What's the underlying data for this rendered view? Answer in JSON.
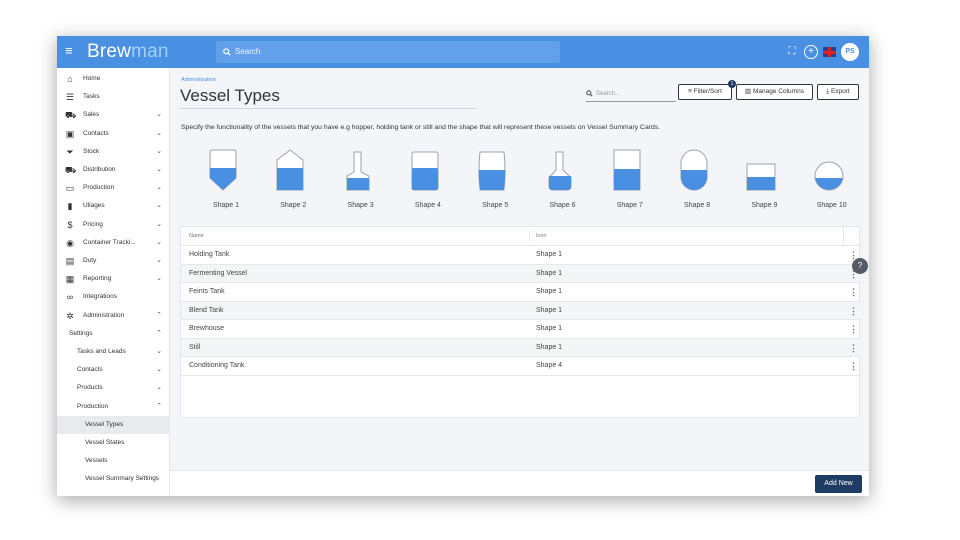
{
  "app": {
    "logo_a": "Brew",
    "logo_b": "man",
    "search_placeholder": "Search",
    "avatar": "PS"
  },
  "sidebar": {
    "items": [
      {
        "label": "Home",
        "icon": "home-icon",
        "chevron": ""
      },
      {
        "label": "Tasks",
        "icon": "list-icon",
        "chevron": ""
      },
      {
        "label": "Sales",
        "icon": "cart-icon",
        "chevron": "⌄"
      },
      {
        "label": "Contacts",
        "icon": "contact-card-icon",
        "chevron": "⌄"
      },
      {
        "label": "Stock",
        "icon": "filter-icon",
        "chevron": "⌄"
      },
      {
        "label": "Distribution",
        "icon": "truck-icon",
        "chevron": "⌄"
      },
      {
        "label": "Production",
        "icon": "tank-icon",
        "chevron": "⌄"
      },
      {
        "label": "Ullages",
        "icon": "bin-icon",
        "chevron": "⌄"
      },
      {
        "label": "Pricing",
        "icon": "dollar-icon",
        "chevron": "⌄"
      },
      {
        "label": "Container Tracki...",
        "icon": "target-icon",
        "chevron": "⌄"
      },
      {
        "label": "Duty",
        "icon": "duty-icon",
        "chevron": "⌄"
      },
      {
        "label": "Reporting",
        "icon": "report-icon",
        "chevron": "⌄"
      },
      {
        "label": "Integrations",
        "icon": "link-icon",
        "chevron": ""
      },
      {
        "label": "Administration",
        "icon": "gear-icon",
        "chevron": "⌃"
      }
    ],
    "settings": {
      "label": "Settings",
      "chevron": "⌃"
    },
    "settings_items": [
      {
        "label": "Tasks and Leads",
        "chevron": "⌄"
      },
      {
        "label": "Contacts",
        "chevron": "⌄"
      },
      {
        "label": "Products",
        "chevron": "⌄"
      },
      {
        "label": "Production",
        "chevron": "⌃"
      }
    ],
    "production_items": [
      {
        "label": "Vessel Types",
        "active": true
      },
      {
        "label": "Vessel States",
        "active": false
      },
      {
        "label": "Vessels",
        "active": false
      },
      {
        "label": "Vessel Summary Settings",
        "active": false
      }
    ]
  },
  "main": {
    "breadcrumb": "Administration",
    "title": "Vessel Types",
    "search_placeholder": "Search...",
    "filter_label": "Filter/Sort",
    "filter_badge": "1",
    "manage_columns_label": "Manage Columns",
    "export_label": "Export",
    "description": "Specify the functionality of the vessels that you have e.g hopper, holding tank or still and the shape that will represent these vessels on Vessel Summary Cards.",
    "shapes": [
      "Shape 1",
      "Shape 2",
      "Shape 3",
      "Shape 4",
      "Shape 5",
      "Shape 6",
      "Shape 7",
      "Shape 8",
      "Shape 9",
      "Shape 10"
    ],
    "table": {
      "headers": {
        "name": "Name",
        "icon": "Icon"
      },
      "rows": [
        {
          "name": "Holding Tank",
          "icon": "Shape 1"
        },
        {
          "name": "Fermenting Vessel",
          "icon": "Shape 1"
        },
        {
          "name": "Feints Tank",
          "icon": "Shape 1"
        },
        {
          "name": "Blend Tank",
          "icon": "Shape 1"
        },
        {
          "name": "Brewhouse",
          "icon": "Shape 1"
        },
        {
          "name": "Still",
          "icon": "Shape 1"
        },
        {
          "name": "Conditioning Tank",
          "icon": "Shape 4"
        }
      ]
    },
    "add_new_label": "Add New"
  },
  "colors": {
    "accent": "#4a90e2",
    "dark": "#1d3b63"
  }
}
